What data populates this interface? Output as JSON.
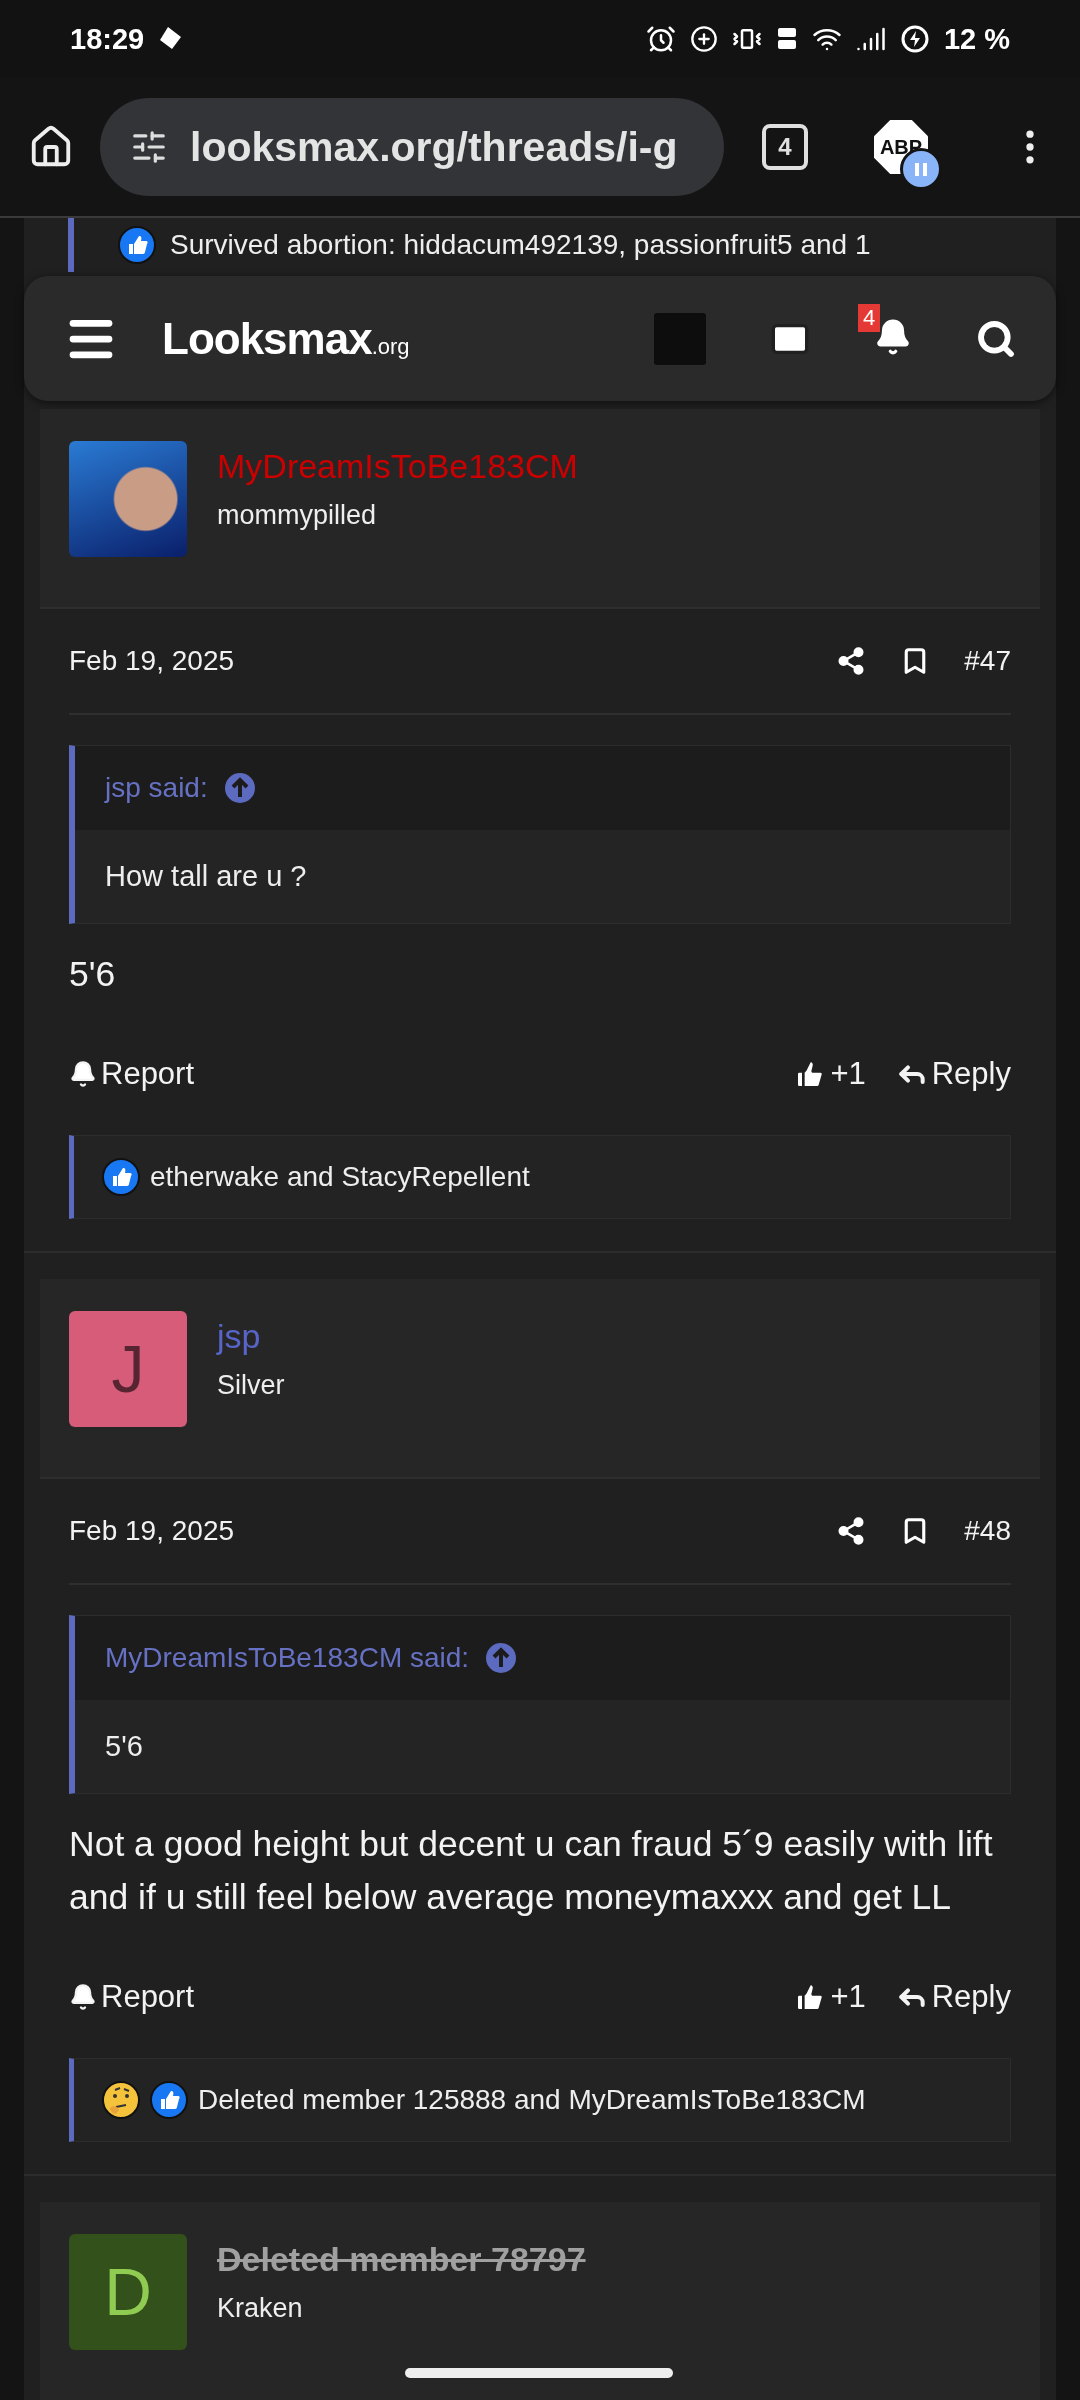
{
  "status_bar": {
    "time": "18:29",
    "battery": "12 %"
  },
  "browser": {
    "url": "looksmax.org/threads/i-g",
    "tab_count": "4",
    "extension_label": "ABP"
  },
  "partial_reaction": {
    "text": "Survived abortion: hiddacum492139, passionfruit5 and 1"
  },
  "site_header": {
    "logo": "Looksmax",
    "logo_suffix": ".org",
    "notification_count": "4"
  },
  "posts": [
    {
      "author": {
        "name": "MyDreamIsToBe183CM",
        "color": "#cc0000",
        "deleted": false,
        "title": "mommypilled"
      },
      "avatar": {
        "kind": "photo"
      },
      "date": "Feb 19, 2025",
      "number": "#47",
      "quote": {
        "author": "jsp said:",
        "text": "How tall are u ?"
      },
      "body": "5'6",
      "actions": {
        "report": "Report",
        "likes": "+1",
        "reply": "Reply"
      },
      "reactions": {
        "icons": [
          {
            "kind": "like"
          }
        ],
        "text": "etherwake and StacyRepellent"
      }
    },
    {
      "author": {
        "name": "jsp",
        "color": "#5865c8",
        "deleted": false,
        "title": "Silver"
      },
      "avatar": {
        "kind": "letter",
        "letter": "J",
        "color": "#d65c7a"
      },
      "date": "Feb 19, 2025",
      "number": "#48",
      "quote": {
        "author": "MyDreamIsToBe183CM said:",
        "text": "5'6"
      },
      "body": "Not a good height but decent u can fraud 5´9 easily with lift and if u still feel below average moneymaxxx and get LL",
      "actions": {
        "report": "Report",
        "likes": "+1",
        "reply": "Reply"
      },
      "reactions": {
        "icons": [
          {
            "kind": "thinking"
          },
          {
            "kind": "like"
          }
        ],
        "text": "Deleted member 125888 and MyDreamIsToBe183CM"
      }
    },
    {
      "author": {
        "name": "Deleted member 78797",
        "color": "#a0a0a0",
        "deleted": true,
        "title": "Kraken"
      },
      "avatar": {
        "kind": "letter",
        "letter": "D",
        "color": "#33511a"
      }
    }
  ]
}
